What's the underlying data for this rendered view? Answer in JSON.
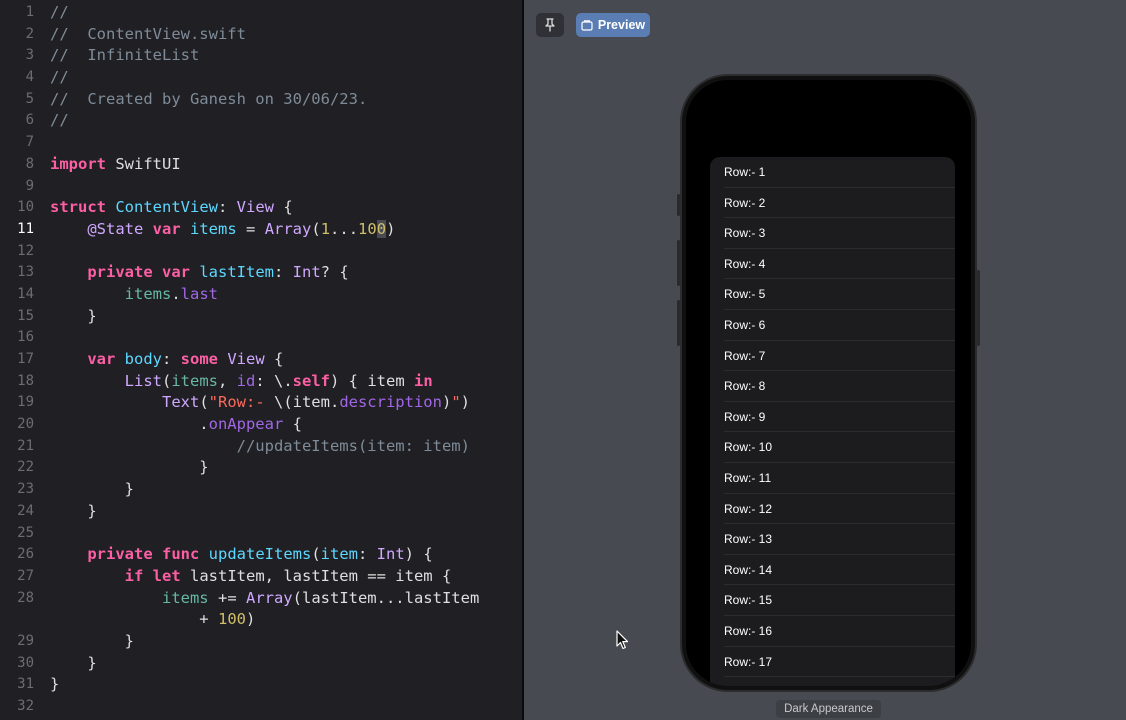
{
  "editor": {
    "current_line": 11,
    "lines": [
      {
        "n": "1",
        "tokens": [
          {
            "c": "com",
            "t": "//"
          }
        ]
      },
      {
        "n": "2",
        "tokens": [
          {
            "c": "com",
            "t": "//  ContentView.swift"
          }
        ]
      },
      {
        "n": "3",
        "tokens": [
          {
            "c": "com",
            "t": "//  InfiniteList"
          }
        ]
      },
      {
        "n": "4",
        "tokens": [
          {
            "c": "com",
            "t": "//"
          }
        ]
      },
      {
        "n": "5",
        "tokens": [
          {
            "c": "com",
            "t": "//  Created by Ganesh on 30/06/23."
          }
        ]
      },
      {
        "n": "6",
        "tokens": [
          {
            "c": "com",
            "t": "//"
          }
        ]
      },
      {
        "n": "7",
        "tokens": []
      },
      {
        "n": "8",
        "tokens": [
          {
            "c": "kw",
            "t": "import"
          },
          {
            "c": "",
            "t": " SwiftUI"
          }
        ]
      },
      {
        "n": "9",
        "tokens": []
      },
      {
        "n": "10",
        "tokens": [
          {
            "c": "kw",
            "t": "struct"
          },
          {
            "c": "",
            "t": " "
          },
          {
            "c": "tyu",
            "t": "ContentView"
          },
          {
            "c": "",
            "t": ": "
          },
          {
            "c": "ty",
            "t": "View"
          },
          {
            "c": "",
            "t": " {"
          }
        ]
      },
      {
        "n": "11",
        "tokens": [
          {
            "c": "",
            "t": "    "
          },
          {
            "c": "ty",
            "t": "@State"
          },
          {
            "c": "",
            "t": " "
          },
          {
            "c": "kw",
            "t": "var"
          },
          {
            "c": "",
            "t": " "
          },
          {
            "c": "tyu",
            "t": "items"
          },
          {
            "c": "",
            "t": " = "
          },
          {
            "c": "ty",
            "t": "Array"
          },
          {
            "c": "",
            "t": "("
          },
          {
            "c": "num",
            "t": "1"
          },
          {
            "c": "",
            "t": "..."
          },
          {
            "c": "num",
            "t": "10"
          },
          {
            "c": "num sel",
            "t": "0"
          },
          {
            "c": "",
            "t": ")"
          }
        ]
      },
      {
        "n": "12",
        "tokens": []
      },
      {
        "n": "13",
        "tokens": [
          {
            "c": "",
            "t": "    "
          },
          {
            "c": "kw",
            "t": "private"
          },
          {
            "c": "",
            "t": " "
          },
          {
            "c": "kw",
            "t": "var"
          },
          {
            "c": "",
            "t": " "
          },
          {
            "c": "tyu",
            "t": "lastItem"
          },
          {
            "c": "",
            "t": ": "
          },
          {
            "c": "ty",
            "t": "Int"
          },
          {
            "c": "",
            "t": "? {"
          }
        ]
      },
      {
        "n": "14",
        "tokens": [
          {
            "c": "",
            "t": "        "
          },
          {
            "c": "id",
            "t": "items"
          },
          {
            "c": "",
            "t": "."
          },
          {
            "c": "fn",
            "t": "last"
          }
        ]
      },
      {
        "n": "15",
        "tokens": [
          {
            "c": "",
            "t": "    }"
          }
        ]
      },
      {
        "n": "16",
        "tokens": []
      },
      {
        "n": "17",
        "tokens": [
          {
            "c": "",
            "t": "    "
          },
          {
            "c": "kw",
            "t": "var"
          },
          {
            "c": "",
            "t": " "
          },
          {
            "c": "tyu",
            "t": "body"
          },
          {
            "c": "",
            "t": ": "
          },
          {
            "c": "kw",
            "t": "some"
          },
          {
            "c": "",
            "t": " "
          },
          {
            "c": "ty",
            "t": "View"
          },
          {
            "c": "",
            "t": " {"
          }
        ]
      },
      {
        "n": "18",
        "tokens": [
          {
            "c": "",
            "t": "        "
          },
          {
            "c": "ty",
            "t": "List"
          },
          {
            "c": "",
            "t": "("
          },
          {
            "c": "id",
            "t": "items"
          },
          {
            "c": "",
            "t": ", "
          },
          {
            "c": "fn",
            "t": "id"
          },
          {
            "c": "",
            "t": ": \\."
          },
          {
            "c": "kw",
            "t": "self"
          },
          {
            "c": "",
            "t": ") { item "
          },
          {
            "c": "kw",
            "t": "in"
          }
        ]
      },
      {
        "n": "19",
        "tokens": [
          {
            "c": "",
            "t": "            "
          },
          {
            "c": "ty",
            "t": "Text"
          },
          {
            "c": "",
            "t": "("
          },
          {
            "c": "str",
            "t": "\"Row:- "
          },
          {
            "c": "",
            "t": "\\(item."
          },
          {
            "c": "fn",
            "t": "description"
          },
          {
            "c": "",
            "t": ")"
          },
          {
            "c": "str",
            "t": "\""
          },
          {
            "c": "",
            "t": ")"
          }
        ]
      },
      {
        "n": "20",
        "tokens": [
          {
            "c": "",
            "t": "                ."
          },
          {
            "c": "fn",
            "t": "onAppear"
          },
          {
            "c": "",
            "t": " {"
          }
        ]
      },
      {
        "n": "21",
        "tokens": [
          {
            "c": "",
            "t": "                    "
          },
          {
            "c": "com",
            "t": "//updateItems(item: item)"
          }
        ]
      },
      {
        "n": "22",
        "tokens": [
          {
            "c": "",
            "t": "                }"
          }
        ]
      },
      {
        "n": "23",
        "tokens": [
          {
            "c": "",
            "t": "        }"
          }
        ]
      },
      {
        "n": "24",
        "tokens": [
          {
            "c": "",
            "t": "    }"
          }
        ]
      },
      {
        "n": "25",
        "tokens": []
      },
      {
        "n": "26",
        "tokens": [
          {
            "c": "",
            "t": "    "
          },
          {
            "c": "kw",
            "t": "private"
          },
          {
            "c": "",
            "t": " "
          },
          {
            "c": "kw",
            "t": "func"
          },
          {
            "c": "",
            "t": " "
          },
          {
            "c": "tyu",
            "t": "updateItems"
          },
          {
            "c": "",
            "t": "("
          },
          {
            "c": "tyu",
            "t": "item"
          },
          {
            "c": "",
            "t": ": "
          },
          {
            "c": "ty",
            "t": "Int"
          },
          {
            "c": "",
            "t": ") {"
          }
        ]
      },
      {
        "n": "27",
        "tokens": [
          {
            "c": "",
            "t": "        "
          },
          {
            "c": "kw",
            "t": "if"
          },
          {
            "c": "",
            "t": " "
          },
          {
            "c": "kw",
            "t": "let"
          },
          {
            "c": "",
            "t": " lastItem, lastItem == item {"
          }
        ]
      },
      {
        "n": "28",
        "tokens": [
          {
            "c": "",
            "t": "            "
          },
          {
            "c": "id",
            "t": "items"
          },
          {
            "c": "",
            "t": " += "
          },
          {
            "c": "ty",
            "t": "Array"
          },
          {
            "c": "",
            "t": "(lastItem...lastItem"
          }
        ]
      },
      {
        "n": "",
        "tokens": [
          {
            "c": "",
            "t": "                + "
          },
          {
            "c": "num",
            "t": "100"
          },
          {
            "c": "",
            "t": ")"
          }
        ]
      },
      {
        "n": "29",
        "tokens": [
          {
            "c": "",
            "t": "        }"
          }
        ]
      },
      {
        "n": "30",
        "tokens": [
          {
            "c": "",
            "t": "    }"
          }
        ]
      },
      {
        "n": "31",
        "tokens": [
          {
            "c": "",
            "t": "}"
          }
        ]
      },
      {
        "n": "32",
        "tokens": []
      }
    ]
  },
  "canvas": {
    "preview_label": "Preview",
    "appearance_label": "Dark Appearance",
    "icons": {
      "pin": "pin-icon",
      "preview": "preview-device-icon",
      "cursor": "mouse-cursor-icon"
    }
  },
  "preview_list": {
    "rows": [
      "Row:- 1",
      "Row:- 2",
      "Row:- 3",
      "Row:- 4",
      "Row:- 5",
      "Row:- 6",
      "Row:- 7",
      "Row:- 8",
      "Row:- 9",
      "Row:- 10",
      "Row:- 11",
      "Row:- 12",
      "Row:- 13",
      "Row:- 14",
      "Row:- 15",
      "Row:- 16",
      "Row:- 17"
    ]
  },
  "colors": {
    "editor_bg": "#1f1f24",
    "canvas_bg": "#474a50",
    "keyword": "#fc5fa3",
    "type": "#d0a8ff",
    "declaration": "#5dd8ff",
    "string": "#fc6a5d",
    "number": "#d0bf69",
    "comment": "#7f8c98",
    "accent": "#5a7db4"
  }
}
